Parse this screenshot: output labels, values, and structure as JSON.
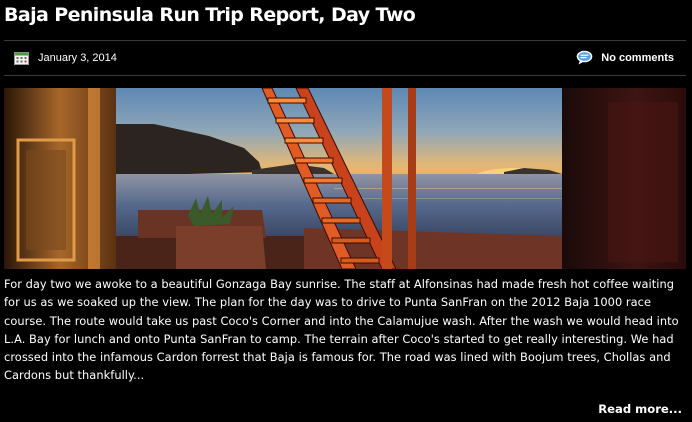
{
  "post": {
    "title": "Baja Peninsula Run Trip Report, Day Two",
    "date": "January 3, 2014",
    "comments": "No comments",
    "image": {
      "icon": "photo-sunrise-through-doorway"
    },
    "excerpt": "For day two we awoke to a beautiful Gonzaga Bay sunrise. The staff at Alfonsinas had made fresh hot coffee waiting for us as we soaked up the view. The plan for the day was to drive to Punta SanFran on the 2012 Baja 1000 race course. The route would take us past Coco's Corner and into the Calamujue wash. After the wash we would head into L.A. Bay for lunch and onto Punta SanFran to camp. The terrain after Coco's started to get really interesting. We had crossed into the infamous Cardon forrest that Baja is famous for. The road was lined with Boojum trees, Chollas and Cardons but thankfully...",
    "read_more": "Read more..."
  },
  "icons": {
    "date": "calendar-icon",
    "comments": "comment-bubble-icon"
  },
  "colors": {
    "background": "#000000",
    "text": "#ffffff",
    "divider": "#3a3a3a",
    "comment_icon": "#5aa0e6",
    "calendar_icon": "#4c9a3c"
  }
}
